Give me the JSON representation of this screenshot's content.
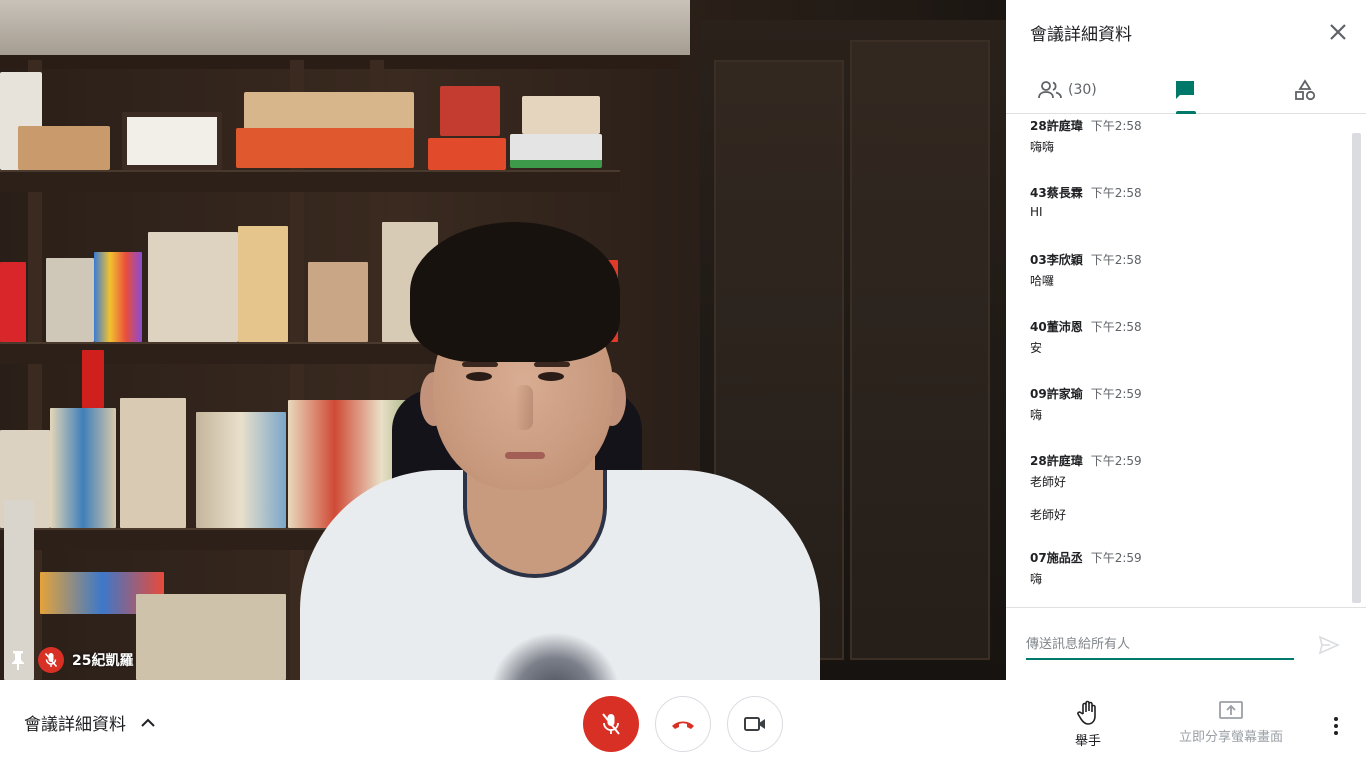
{
  "video": {
    "participant_name": "25紀凱羅",
    "mic_muted": true
  },
  "panel": {
    "title": "會議詳細資料",
    "close_icon": "close-icon",
    "tabs": [
      {
        "id": "people",
        "icon": "people-icon",
        "count": "(30)"
      },
      {
        "id": "chat",
        "icon": "chat-icon",
        "active": true
      },
      {
        "id": "activities",
        "icon": "shapes-icon"
      }
    ],
    "messages": [
      {
        "sender": "28許庭瑋",
        "time": "下午2:58",
        "text": "嗨嗨"
      },
      {
        "sender": "43蔡長霖",
        "time": "下午2:58",
        "text": "HI"
      },
      {
        "sender": "03李欣穎",
        "time": "下午2:58",
        "text": "哈囉"
      },
      {
        "sender": "40董沛恩",
        "time": "下午2:58",
        "text": "安"
      },
      {
        "sender": "09許家瑜",
        "time": "下午2:59",
        "text": "嗨"
      },
      {
        "sender": "28許庭瑋",
        "time": "下午2:59",
        "text": "老師好",
        "text2": "老師好"
      },
      {
        "sender": "07施品丞",
        "time": "下午2:59",
        "text": "嗨"
      }
    ],
    "composer": {
      "placeholder": "傳送訊息給所有人",
      "value": ""
    }
  },
  "bottom": {
    "details_label": "會議詳細資料",
    "raise_hand_label": "舉手",
    "present_label": "立即分享螢幕畫面"
  },
  "colors": {
    "accent": "#00796b",
    "danger": "#d93025",
    "text": "#202124",
    "muted": "#5f6368"
  }
}
